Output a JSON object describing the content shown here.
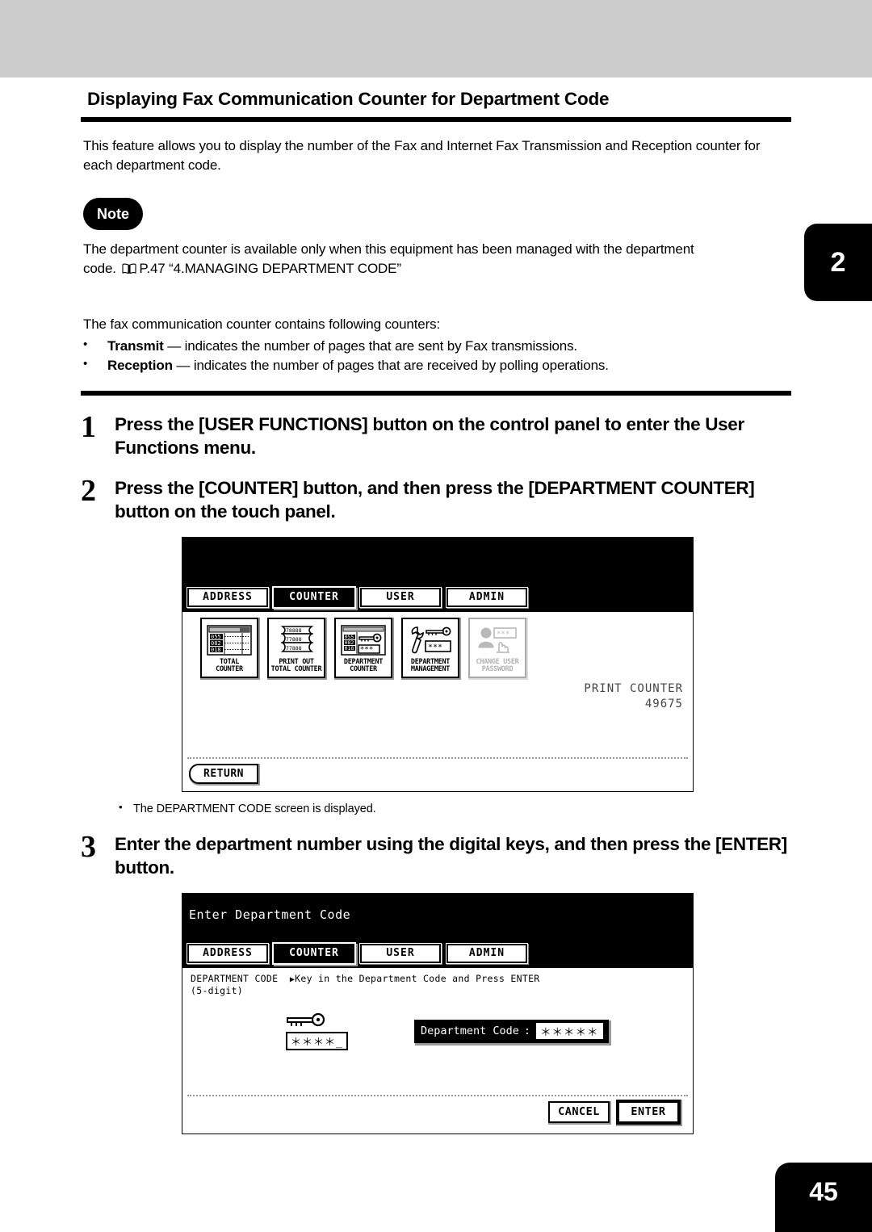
{
  "chapter_tab": "2",
  "page_number": "45",
  "page_title": "Displaying Fax Communication Counter for Department Code",
  "intro": "This feature allows you to display the number of the Fax and Internet Fax Transmission and Reception counter for each department code.",
  "note": {
    "badge": "Note",
    "line1": "The department counter is available only when this equipment has been managed with the department",
    "line2_prefix": "code.",
    "line2_ref": "P.47 “4.MANAGING DEPARTMENT CODE”"
  },
  "counters_intro": "The fax communication counter contains following counters:",
  "bullets": [
    {
      "term": "Transmit",
      "desc": " — indicates the number of pages that are sent by Fax transmissions."
    },
    {
      "term": "Reception",
      "desc": " — indicates the number of pages that are received by polling operations."
    }
  ],
  "steps": [
    {
      "num": "1",
      "text": "Press the [USER FUNCTIONS] button on the control panel to enter the User Functions menu."
    },
    {
      "num": "2",
      "text": "Press the [COUNTER] button, and then press the [DEPARTMENT COUNTER] button on the touch panel."
    },
    {
      "num": "3",
      "text": "Enter the department number using the digital keys, and then press the [ENTER] button."
    }
  ],
  "step2_note": "The DEPARTMENT CODE screen is displayed.",
  "panel1": {
    "tabs": [
      {
        "label": "ADDRESS",
        "selected": false
      },
      {
        "label": "COUNTER",
        "selected": true
      },
      {
        "label": "USER",
        "selected": false
      },
      {
        "label": "ADMIN",
        "selected": false
      }
    ],
    "icons": [
      {
        "name": "total-counter",
        "caption": "TOTAL\nCOUNTER",
        "disabled": false
      },
      {
        "name": "print-out-total-counter",
        "caption": "PRINT OUT\nTOTAL COUNTER",
        "disabled": false
      },
      {
        "name": "department-counter",
        "caption": "DEPARTMENT\nCOUNTER",
        "disabled": false
      },
      {
        "name": "department-management",
        "caption": "DEPARTMENT\nMANAGEMENT",
        "disabled": false
      },
      {
        "name": "change-user-password",
        "caption": "CHANGE USER\nPASSWORD",
        "disabled": true
      }
    ],
    "print_counter_label": "PRINT COUNTER",
    "print_counter_value": "49675",
    "return_label": "RETURN"
  },
  "panel2": {
    "title": "Enter Department Code",
    "tabs": [
      {
        "label": "ADDRESS",
        "selected": false
      },
      {
        "label": "COUNTER",
        "selected": true
      },
      {
        "label": "USER",
        "selected": false
      },
      {
        "label": "ADMIN",
        "selected": false
      }
    ],
    "prompt_label": "DEPARTMENT CODE",
    "prompt_text": "Key in the Department Code and Press ENTER",
    "prompt_sub": "(5-digit)",
    "key_mask": "＊＊＊＊_",
    "field_label": "Department Code",
    "field_colon": ":",
    "field_value": "＊＊＊＊＊",
    "cancel_label": "CANCEL",
    "enter_label": "ENTER"
  },
  "colors": {
    "band": "#cccccc",
    "ink": "#000000",
    "disabled": "#b3b3b3"
  }
}
